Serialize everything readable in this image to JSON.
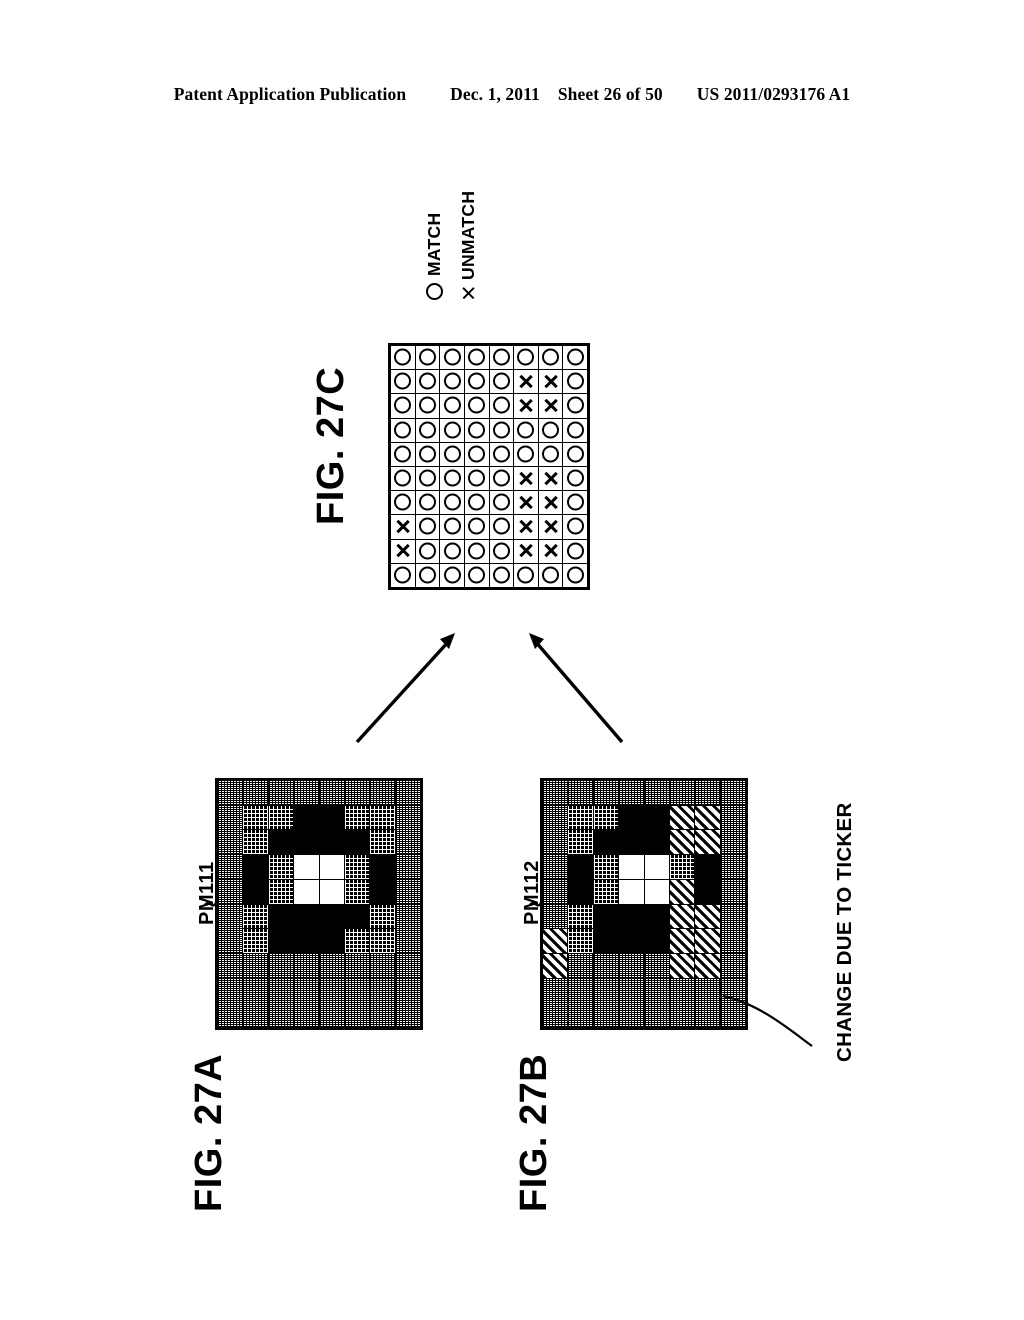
{
  "header": {
    "publication": "Patent Application Publication",
    "date": "Dec. 1, 2011",
    "sheet": "Sheet 26 of 50",
    "patent_number": "US 2011/0293176 A1"
  },
  "figures": {
    "fig_a_label": "FIG. 27A",
    "fig_b_label": "FIG. 27B",
    "fig_c_label": "FIG. 27C"
  },
  "annotations": {
    "pm111": "PM111",
    "pm112": "PM112",
    "change_note": "CHANGE DUE TO TICKER"
  },
  "legend": {
    "match_symbol": "circle-icon",
    "match_label": "MATCH",
    "unmatch_symbol": "cross-icon",
    "unmatch_label": "UNMATCH"
  },
  "chart_data": {
    "type": "heatmap",
    "title": "FIG. 27C",
    "description": "8 column by 10 row comparison map of pattern PM111 vs PM112",
    "columns": 8,
    "rows": 10,
    "value_map": {
      "o": "MATCH",
      "x": "UNMATCH"
    },
    "cells": [
      [
        "o",
        "o",
        "o",
        "o",
        "o",
        "o",
        "o",
        "o"
      ],
      [
        "o",
        "o",
        "o",
        "o",
        "o",
        "x",
        "x",
        "o"
      ],
      [
        "o",
        "o",
        "o",
        "o",
        "o",
        "x",
        "x",
        "o"
      ],
      [
        "o",
        "o",
        "o",
        "o",
        "o",
        "o",
        "o",
        "o"
      ],
      [
        "o",
        "o",
        "o",
        "o",
        "o",
        "o",
        "o",
        "o"
      ],
      [
        "o",
        "o",
        "o",
        "o",
        "o",
        "x",
        "x",
        "o"
      ],
      [
        "o",
        "o",
        "o",
        "o",
        "o",
        "x",
        "x",
        "o"
      ],
      [
        "x",
        "o",
        "o",
        "o",
        "o",
        "x",
        "x",
        "o"
      ],
      [
        "x",
        "o",
        "o",
        "o",
        "o",
        "x",
        "x",
        "o"
      ],
      [
        "o",
        "o",
        "o",
        "o",
        "o",
        "o",
        "o",
        "o"
      ]
    ]
  },
  "pattern_a": {
    "name": "PM111",
    "columns": 8,
    "rows": 10,
    "fill_map": {
      "L": "light-dither",
      "D": "dark-dither",
      "K": "black",
      "W": "white",
      "H": "diagonal-hatch"
    },
    "cells": [
      [
        "L",
        "L",
        "L",
        "L",
        "L",
        "L",
        "L",
        "L"
      ],
      [
        "L",
        "D",
        "D",
        "K",
        "K",
        "D",
        "D",
        "L"
      ],
      [
        "L",
        "D",
        "K",
        "K",
        "K",
        "K",
        "D",
        "L"
      ],
      [
        "L",
        "K",
        "D",
        "W",
        "W",
        "D",
        "K",
        "L"
      ],
      [
        "L",
        "K",
        "D",
        "W",
        "W",
        "D",
        "K",
        "L"
      ],
      [
        "L",
        "D",
        "K",
        "K",
        "K",
        "K",
        "D",
        "L"
      ],
      [
        "L",
        "D",
        "K",
        "K",
        "K",
        "D",
        "D",
        "L"
      ],
      [
        "L",
        "L",
        "L",
        "L",
        "L",
        "L",
        "L",
        "L"
      ],
      [
        "L",
        "L",
        "L",
        "L",
        "L",
        "L",
        "L",
        "L"
      ],
      [
        "L",
        "L",
        "L",
        "L",
        "L",
        "L",
        "L",
        "L"
      ]
    ]
  },
  "pattern_b": {
    "name": "PM112",
    "columns": 8,
    "rows": 10,
    "fill_map": {
      "L": "light-dither",
      "D": "dark-dither",
      "K": "black",
      "W": "white",
      "H": "diagonal-hatch"
    },
    "cells": [
      [
        "L",
        "L",
        "L",
        "L",
        "L",
        "L",
        "L",
        "L"
      ],
      [
        "L",
        "D",
        "D",
        "K",
        "K",
        "H",
        "H",
        "L"
      ],
      [
        "L",
        "D",
        "K",
        "K",
        "K",
        "H",
        "H",
        "L"
      ],
      [
        "L",
        "K",
        "D",
        "W",
        "W",
        "D",
        "K",
        "L"
      ],
      [
        "L",
        "K",
        "D",
        "W",
        "W",
        "H",
        "K",
        "L"
      ],
      [
        "L",
        "D",
        "K",
        "K",
        "K",
        "H",
        "H",
        "L"
      ],
      [
        "H",
        "D",
        "K",
        "K",
        "K",
        "H",
        "H",
        "L"
      ],
      [
        "H",
        "L",
        "L",
        "L",
        "L",
        "H",
        "H",
        "L"
      ],
      [
        "L",
        "L",
        "L",
        "L",
        "L",
        "L",
        "L",
        "L"
      ],
      [
        "L",
        "L",
        "L",
        "L",
        "L",
        "L",
        "L",
        "L"
      ]
    ]
  }
}
